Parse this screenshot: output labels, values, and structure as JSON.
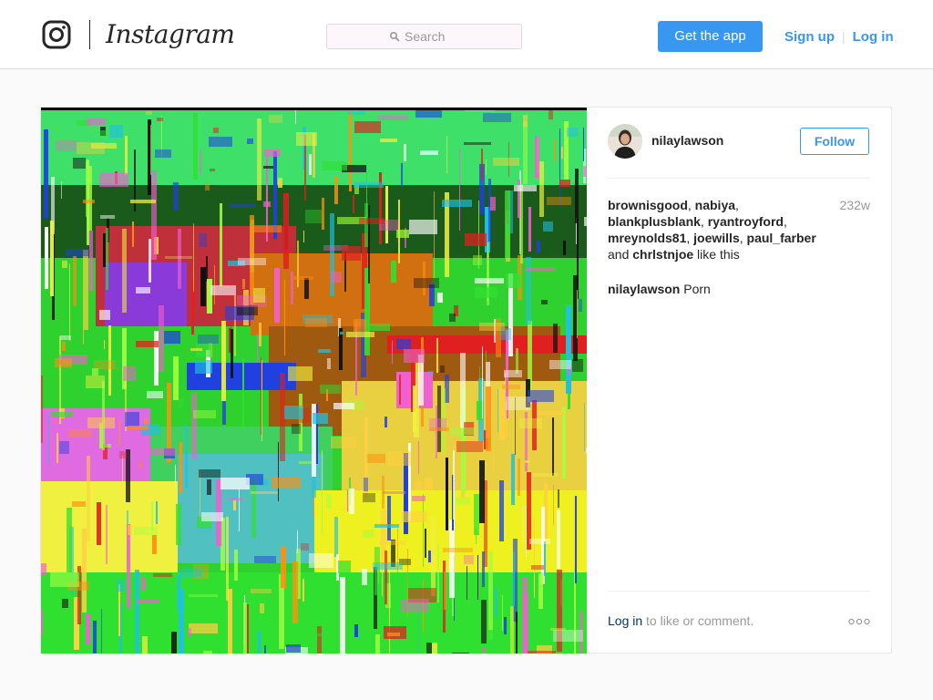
{
  "brand": {
    "wordmark": "Instagram",
    "icon": "instagram-camera-icon"
  },
  "search": {
    "placeholder": "Search",
    "icon": "search-icon"
  },
  "nav": {
    "get_app_label": "Get the app",
    "signup_label": "Sign up",
    "separator": "|",
    "login_label": "Log in"
  },
  "post": {
    "username": "nilaylawson",
    "follow_label": "Follow",
    "likers": [
      "brownisgood",
      "nabiya",
      "blankplusblank",
      "ryantroyford",
      "mreynolds81",
      "joewills",
      "paul_farber"
    ],
    "likers_separator": ", ",
    "likes_and": "and",
    "last_liker": "chrlstnjoe",
    "likes_suffix": "like this",
    "age": "232w",
    "caption_user": "nilaylawson",
    "caption_text": "Porn",
    "footer_login_label": "Log in",
    "footer_text": "to like or comment.",
    "more_icon": "more-options-icon"
  },
  "colors": {
    "accent": "#3897f0",
    "text": "#262626",
    "muted": "#999999",
    "border": "#dbdbdb",
    "background": "#fafafa",
    "footer_link": "#003569"
  }
}
